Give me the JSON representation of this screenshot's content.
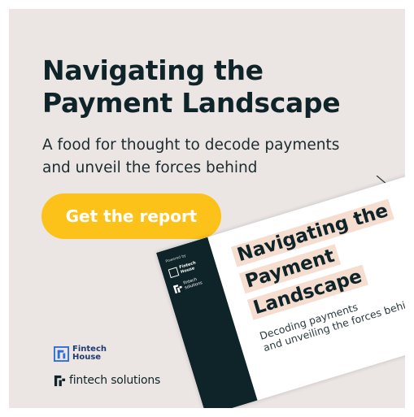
{
  "ad": {
    "title_line1": "Navigating the",
    "title_line2": "Payment Landscape",
    "subtitle_line1": "A food for thought to decode payments",
    "subtitle_line2": "and unveil the forces behind",
    "cta_label": "Get the report"
  },
  "logos": {
    "fintech_house_line1": "Fintech",
    "fintech_house_line2": "House",
    "fintech_solutions": "fintech solutions"
  },
  "report_cover": {
    "powered_by": "Powered by",
    "logo1_line1": "Fintech",
    "logo1_line2": "House",
    "logo2_line1": "fintech",
    "logo2_line2": "solutions",
    "title_line1": "Navigating the",
    "title_line2": "Payment",
    "title_line3": "Landscape",
    "subtitle_line1": "Decoding payments",
    "subtitle_line2": "and unveiling the forces behind"
  },
  "colors": {
    "background": "#ebe6e4",
    "heading": "#0f2428",
    "accent_yellow": "#fcc219",
    "logo_blue": "#1f3a70",
    "highlight": "#f5ddd0"
  },
  "icons": [
    "fintech-house-logo-icon",
    "fintech-solutions-logo-icon"
  ]
}
